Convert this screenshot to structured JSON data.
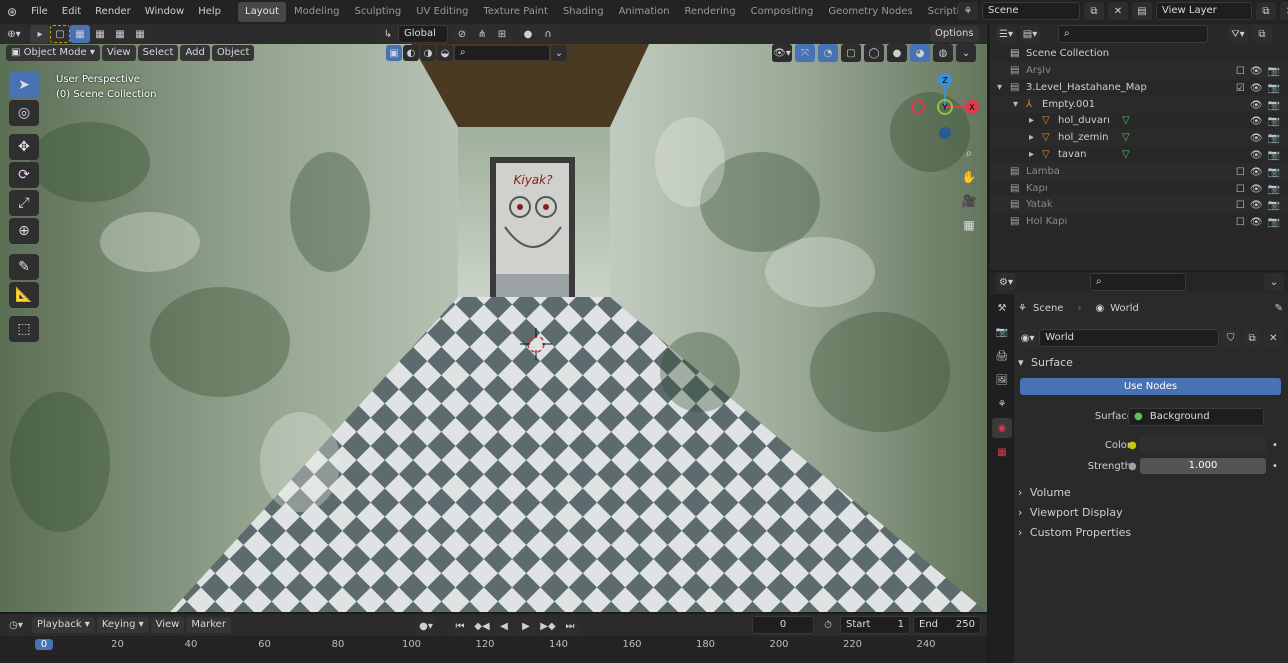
{
  "menu": {
    "file": "File",
    "edit": "Edit",
    "render": "Render",
    "window": "Window",
    "help": "Help"
  },
  "workspaces": [
    "Layout",
    "Modeling",
    "Sculpting",
    "UV Editing",
    "Texture Paint",
    "Shading",
    "Animation",
    "Rendering",
    "Compositing",
    "Geometry Nodes",
    "Scripting"
  ],
  "active_workspace": "Layout",
  "scene_name": "Scene",
  "view_layer": "View Layer",
  "toolbar": {
    "transform_orientation": "Global",
    "options": "Options"
  },
  "viewport_header": {
    "mode": "Object Mode",
    "view": "View",
    "select": "Select",
    "add": "Add",
    "object": "Object"
  },
  "viewport_overlay": {
    "line1": "User Perspective",
    "line2": "(0) Scene Collection"
  },
  "scene_text": {
    "door_graffiti": "Kiyak?"
  },
  "gizmo": {
    "x": "X",
    "y": "Y",
    "z": "Z"
  },
  "outliner": {
    "root": "Scene Collection",
    "rows": [
      {
        "label": "Arşiv",
        "depth": 1,
        "dim": true,
        "checkbox": false
      },
      {
        "label": "3.Level_Hastahane_Map",
        "depth": 1,
        "dim": false,
        "checkbox": true
      },
      {
        "label": "Empty.001",
        "depth": 2,
        "dim": false
      },
      {
        "label": "hol_duvarı",
        "depth": 3,
        "dim": false
      },
      {
        "label": "hol_zemin",
        "depth": 3,
        "dim": false
      },
      {
        "label": "tavan",
        "depth": 3,
        "dim": false
      },
      {
        "label": "Lamba",
        "depth": 1,
        "dim": true,
        "checkbox": false
      },
      {
        "label": "Kapı",
        "depth": 1,
        "dim": true,
        "checkbox": false
      },
      {
        "label": "Yatak",
        "depth": 1,
        "dim": true,
        "checkbox": false
      },
      {
        "label": "Hol Kapı",
        "depth": 1,
        "dim": true,
        "checkbox": false
      }
    ]
  },
  "properties": {
    "breadcrumb_scene": "Scene",
    "breadcrumb_world": "World",
    "world_name": "World",
    "surface_panel": "Surface",
    "use_nodes": "Use Nodes",
    "surface_label": "Surface",
    "surface_value": "Background",
    "color_label": "Color",
    "strength_label": "Strength",
    "strength_value": "1.000",
    "volume": "Volume",
    "viewport_display": "Viewport Display",
    "custom_properties": "Custom Properties"
  },
  "timeline": {
    "playback": "Playback",
    "keying": "Keying",
    "view": "View",
    "marker": "Marker",
    "current_frame": "0",
    "start_label": "Start",
    "start_value": "1",
    "end_label": "End",
    "end_value": "250",
    "frame_marks": [
      "0",
      "20",
      "40",
      "60",
      "80",
      "100",
      "120",
      "140",
      "160",
      "180",
      "200",
      "220",
      "240"
    ]
  },
  "colors": {
    "accent": "#4772b3",
    "axis_x": "#e0394c",
    "axis_y": "#8bc34a",
    "axis_z": "#3d8fdc"
  }
}
